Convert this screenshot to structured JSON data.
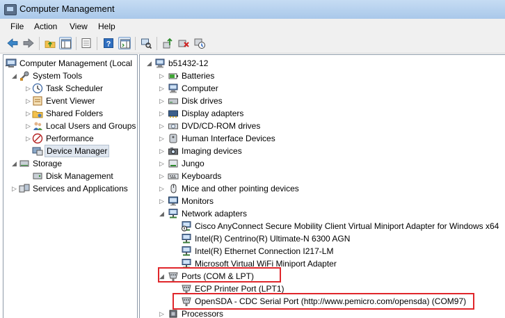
{
  "window": {
    "title": "Computer Management"
  },
  "menu": [
    "File",
    "Action",
    "View",
    "Help"
  ],
  "toolbar": {
    "buttons": [
      {
        "name": "back-icon"
      },
      {
        "name": "forward-icon"
      },
      {
        "name": "up-folder-icon"
      },
      {
        "name": "show-hide-tree-icon"
      },
      {
        "name": "properties-icon"
      },
      {
        "name": "help-icon"
      },
      {
        "name": "show-hide-action-pane-icon"
      },
      {
        "name": "scan-hardware-icon"
      },
      {
        "name": "update-driver-icon"
      },
      {
        "name": "uninstall-icon"
      },
      {
        "name": "disable-icon"
      }
    ]
  },
  "left_tree": [
    {
      "label": "Computer Management (Local",
      "icon": "computer-management-icon",
      "level": 0,
      "expander": "down"
    },
    {
      "label": "System Tools",
      "icon": "system-tools-icon",
      "level": 1,
      "expander": "down"
    },
    {
      "label": "Task Scheduler",
      "icon": "task-scheduler-icon",
      "level": 2,
      "expander": "right"
    },
    {
      "label": "Event Viewer",
      "icon": "event-viewer-icon",
      "level": 2,
      "expander": "right"
    },
    {
      "label": "Shared Folders",
      "icon": "shared-folders-icon",
      "level": 2,
      "expander": "right"
    },
    {
      "label": "Local Users and Groups",
      "icon": "local-users-icon",
      "level": 2,
      "expander": "right"
    },
    {
      "label": "Performance",
      "icon": "performance-icon",
      "level": 2,
      "expander": "right"
    },
    {
      "label": "Device Manager",
      "icon": "device-manager-icon",
      "level": 2,
      "expander": "none",
      "selected": true
    },
    {
      "label": "Storage",
      "icon": "storage-icon",
      "level": 1,
      "expander": "down"
    },
    {
      "label": "Disk Management",
      "icon": "disk-management-icon",
      "level": 2,
      "expander": "none"
    },
    {
      "label": "Services and Applications",
      "icon": "services-icon",
      "level": 1,
      "expander": "right"
    }
  ],
  "device_tree": [
    {
      "label": "b51432-12",
      "icon": "computer-icon",
      "level": 0,
      "expander": "down"
    },
    {
      "label": "Batteries",
      "icon": "battery-icon",
      "level": 1,
      "expander": "right"
    },
    {
      "label": "Computer",
      "icon": "computer-icon",
      "level": 1,
      "expander": "right"
    },
    {
      "label": "Disk drives",
      "icon": "disk-drive-icon",
      "level": 1,
      "expander": "right"
    },
    {
      "label": "Display adapters",
      "icon": "display-adapter-icon",
      "level": 1,
      "expander": "right"
    },
    {
      "label": "DVD/CD-ROM drives",
      "icon": "dvd-drive-icon",
      "level": 1,
      "expander": "right"
    },
    {
      "label": "Human Interface Devices",
      "icon": "hid-icon",
      "level": 1,
      "expander": "right"
    },
    {
      "label": "Imaging devices",
      "icon": "imaging-device-icon",
      "level": 1,
      "expander": "right"
    },
    {
      "label": "Jungo",
      "icon": "jungo-icon",
      "level": 1,
      "expander": "right"
    },
    {
      "label": "Keyboards",
      "icon": "keyboard-icon",
      "level": 1,
      "expander": "right"
    },
    {
      "label": "Mice and other pointing devices",
      "icon": "mouse-icon",
      "level": 1,
      "expander": "right"
    },
    {
      "label": "Monitors",
      "icon": "monitor-icon",
      "level": 1,
      "expander": "right"
    },
    {
      "label": "Network adapters",
      "icon": "network-adapter-icon",
      "level": 1,
      "expander": "down"
    },
    {
      "label": "Cisco AnyConnect Secure Mobility Client Virtual Miniport Adapter for Windows x64",
      "icon": "network-adapter-warning-icon",
      "level": 2,
      "expander": "none"
    },
    {
      "label": "Intel(R) Centrino(R) Ultimate-N 6300 AGN",
      "icon": "network-adapter-icon",
      "level": 2,
      "expander": "none"
    },
    {
      "label": "Intel(R) Ethernet Connection I217-LM",
      "icon": "network-adapter-icon",
      "level": 2,
      "expander": "none"
    },
    {
      "label": "Microsoft Virtual WiFi Miniport Adapter",
      "icon": "network-adapter-icon",
      "level": 2,
      "expander": "none"
    },
    {
      "label": "Ports (COM & LPT)",
      "icon": "port-icon",
      "level": 1,
      "expander": "down",
      "highlight": true
    },
    {
      "label": "ECP Printer Port (LPT1)",
      "icon": "port-icon",
      "level": 2,
      "expander": "none"
    },
    {
      "label": "OpenSDA - CDC Serial Port (http://www.pemicro.com/opensda) (COM97)",
      "icon": "port-icon",
      "level": 2,
      "expander": "none",
      "highlight": true
    },
    {
      "label": "Processors",
      "icon": "processor-icon",
      "level": 1,
      "expander": "right"
    }
  ],
  "colors": {
    "highlight": "#e0262b",
    "selection": "#dfe6ef",
    "titlebar": "#a9c8ea"
  }
}
